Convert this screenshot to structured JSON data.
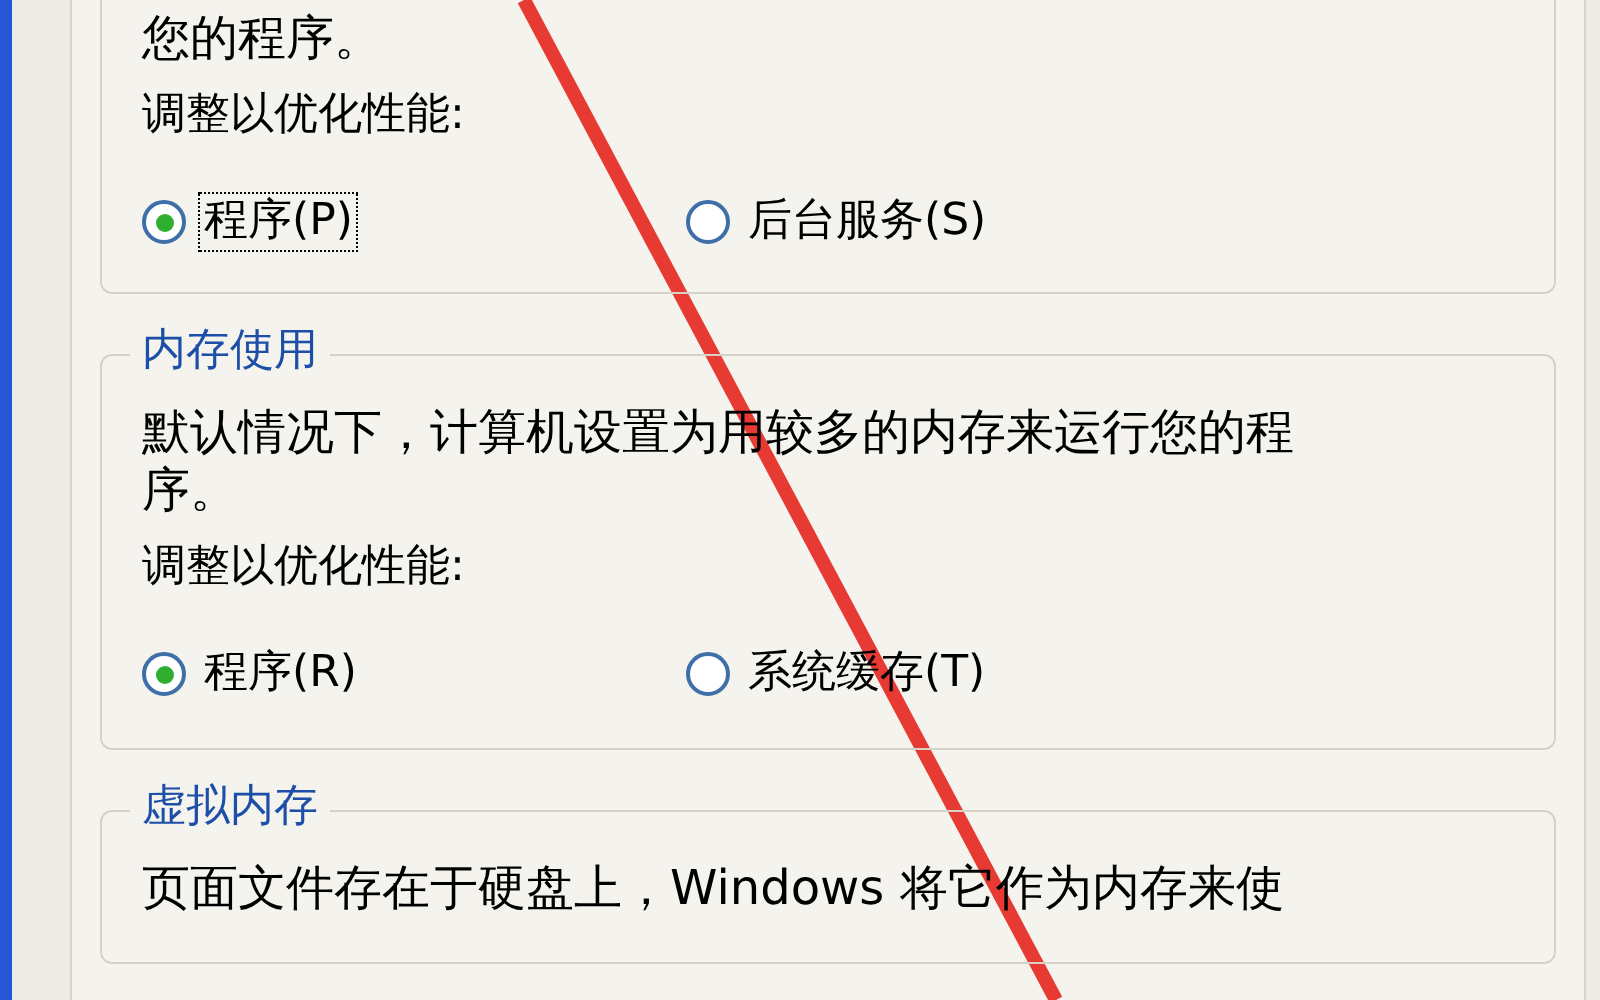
{
  "groups": [
    {
      "description": "您的程序。",
      "prompt": "调整以优化性能:",
      "options": [
        {
          "label": "程序(P)",
          "selected": true,
          "focused": true
        },
        {
          "label": "后台服务(S)",
          "selected": false,
          "focused": false
        }
      ]
    },
    {
      "legend": "内存使用",
      "description": "默认情况下，计算机设置为用较多的内存来运行您的程序。",
      "prompt": "调整以优化性能:",
      "options": [
        {
          "label": "程序(R)",
          "selected": true,
          "focused": false
        },
        {
          "label": "系统缓存(T)",
          "selected": false,
          "focused": false
        }
      ]
    },
    {
      "legend": "虚拟内存",
      "description": "页面文件存在于硬盘上，Windows 将它作为内存来使"
    }
  ]
}
